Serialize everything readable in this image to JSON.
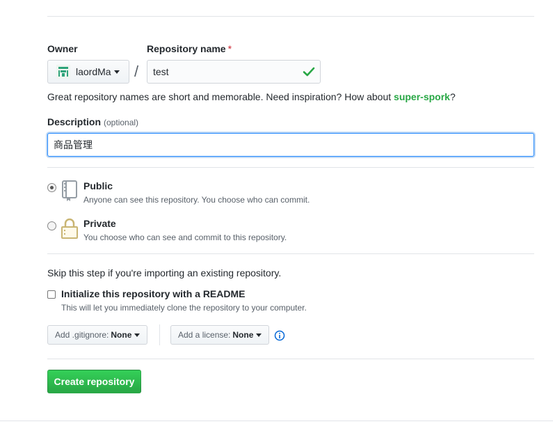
{
  "owner": {
    "label": "Owner",
    "selected": "laordMa"
  },
  "repo_name": {
    "label": "Repository name",
    "required_mark": "*",
    "separator": "/",
    "value": "test",
    "valid_icon": "check-icon"
  },
  "hint": {
    "text": "Great repository names are short and memorable. Need inspiration? How about ",
    "suggestion": "super-spork",
    "end": "?"
  },
  "description": {
    "label": "Description",
    "optional": "(optional)",
    "value": "商品管理"
  },
  "visibility": {
    "public": {
      "title": "Public",
      "desc": "Anyone can see this repository. You choose who can commit.",
      "selected": true,
      "icon": "repo-book-icon"
    },
    "private": {
      "title": "Private",
      "desc": "You choose who can see and commit to this repository.",
      "selected": false,
      "icon": "lock-icon"
    }
  },
  "skip_text": "Skip this step if you're importing an existing repository.",
  "readme": {
    "label": "Initialize this repository with a README",
    "note": "This will let you immediately clone the repository to your computer.",
    "checked": false
  },
  "gitignore": {
    "label": "Add .gitignore:",
    "value": "None"
  },
  "license": {
    "label": "Add a license:",
    "value": "None"
  },
  "create_button": "Create repository",
  "colors": {
    "accent_green": "#28a745",
    "focus_blue": "#2188ff",
    "required_red": "#cb2431",
    "info_blue": "#0366d6"
  }
}
